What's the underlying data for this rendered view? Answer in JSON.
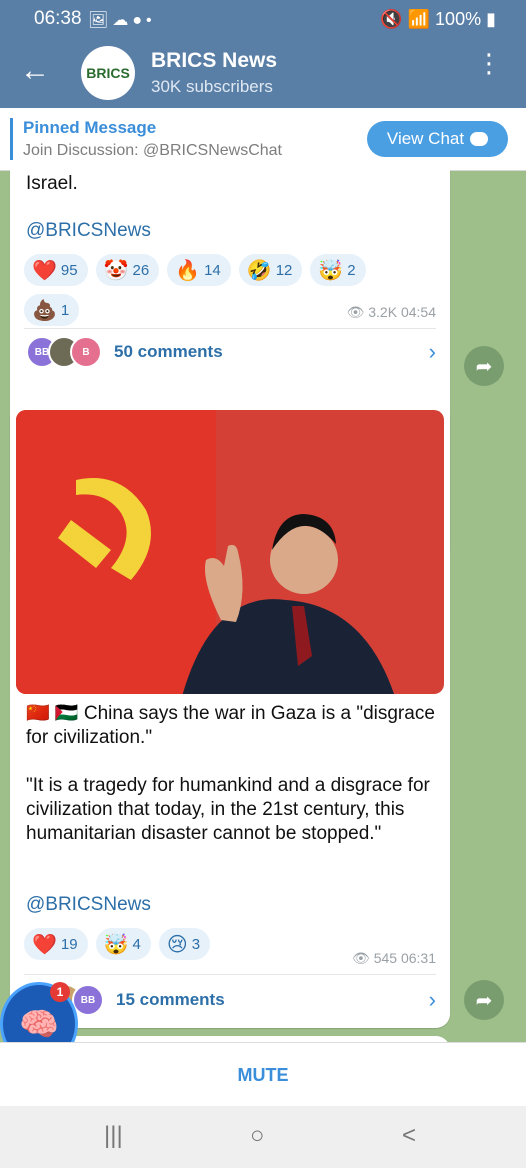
{
  "status_bar": {
    "time": "06:38",
    "battery": "100%"
  },
  "channel": {
    "title": "BRICS News",
    "subscribers": "30K subscribers",
    "avatar_text": "BRICS"
  },
  "pinned": {
    "title": "Pinned Message",
    "text": "Join Discussion: @BRICSNewsChat",
    "button": "View Chat"
  },
  "msg1": {
    "text": "Israel.",
    "link": "@BRICSNews",
    "reactions": [
      {
        "emoji": "❤️",
        "count": "95"
      },
      {
        "emoji": "🤡",
        "count": "26"
      },
      {
        "emoji": "🔥",
        "count": "14"
      },
      {
        "emoji": "🤣",
        "count": "12"
      },
      {
        "emoji": "🤯",
        "count": "2"
      },
      {
        "emoji": "💩",
        "count": "1"
      }
    ],
    "views": "3.2K",
    "time": "04:54",
    "comments": "50 comments",
    "avatars": [
      "BB",
      "",
      "B"
    ]
  },
  "msg2": {
    "flags": "🇨🇳 🇵🇸",
    "headline": "China says the war in Gaza is a \"disgrace for civilization.\"",
    "quote": "\"It is a tragedy for humankind and a disgrace for civilization that today, in the 21st century, this humanitarian disaster cannot be stopped.\"",
    "link": "@BRICSNews",
    "reactions": [
      {
        "emoji": "❤️",
        "count": "19"
      },
      {
        "emoji": "🤯",
        "count": "4"
      },
      {
        "emoji": "😢",
        "count": "3"
      }
    ],
    "views": "545",
    "time": "06:31",
    "comments": "15 comments",
    "avatars": [
      "👶",
      "BB"
    ]
  },
  "bubble_badge": "1",
  "mute": "MUTE",
  "nav": {
    "recents": "|||",
    "home": "○",
    "back": "<"
  }
}
